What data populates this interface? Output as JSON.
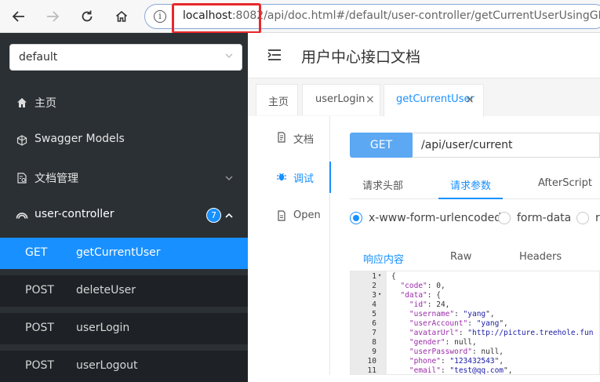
{
  "browser": {
    "url_host": "localhost",
    "url_port": ":8082",
    "url_path": "/api/doc.html#/default/user-controller/getCurrentUserUsingGET"
  },
  "sidebar": {
    "group_select": "default",
    "menu": [
      {
        "label": "主页",
        "icon": "home-icon"
      },
      {
        "label": "Swagger Models",
        "icon": "models-icon"
      },
      {
        "label": "文档管理",
        "icon": "document-manage-icon"
      },
      {
        "label": "user-controller",
        "icon": "controller-icon",
        "badge": "7"
      }
    ],
    "endpoints": [
      {
        "method": "GET",
        "name": "getCurrentUser",
        "active": true
      },
      {
        "method": "POST",
        "name": "deleteUser"
      },
      {
        "method": "POST",
        "name": "userLogin"
      },
      {
        "method": "POST",
        "name": "userLogout"
      }
    ]
  },
  "header": {
    "title": "用户中心接口文档"
  },
  "tabs": [
    {
      "label": "主页"
    },
    {
      "label": "userLogin",
      "close": "×"
    },
    {
      "label": "getCurrentUser",
      "close": "×"
    }
  ],
  "side_tabs": [
    {
      "label": "文档"
    },
    {
      "label": "调试"
    },
    {
      "label": "Open"
    }
  ],
  "request": {
    "method": "GET",
    "path": "/api/user/current",
    "tabs": [
      "请求头部",
      "请求参数",
      "AfterScript"
    ],
    "body_types": [
      "x-www-form-urlencoded",
      "form-data",
      "ra"
    ],
    "selected_body_type": "x-www-form-urlencoded"
  },
  "response": {
    "tabs": [
      "响应内容",
      "Raw",
      "Headers"
    ],
    "lines": [
      {
        "n": "1",
        "fold": "▾",
        "text": "{"
      },
      {
        "n": "2",
        "fold": "",
        "text": "  \"code\": 0,"
      },
      {
        "n": "3",
        "fold": "▾",
        "text": "  \"data\": {"
      },
      {
        "n": "4",
        "fold": "",
        "text": "    \"id\": 24,"
      },
      {
        "n": "5",
        "fold": "",
        "text": "    \"username\": \"yang\","
      },
      {
        "n": "6",
        "fold": "",
        "text": "    \"userAccount\": \"yang\","
      },
      {
        "n": "7",
        "fold": "",
        "text": "    \"avatarUrl\": \"http://picture.treehole.fun"
      },
      {
        "n": "8",
        "fold": "",
        "text": "    \"gender\": null,"
      },
      {
        "n": "9",
        "fold": "",
        "text": "    \"userPassword\": null,"
      },
      {
        "n": "10",
        "fold": "",
        "text": "    \"phone\": \"123432543\","
      },
      {
        "n": "11",
        "fold": "",
        "text": "    \"email\": \"test@qq.com\","
      }
    ]
  },
  "colors": {
    "accent": "#1890ff",
    "sidebar_bg": "#2b3034",
    "highlight": "#e8282b"
  }
}
